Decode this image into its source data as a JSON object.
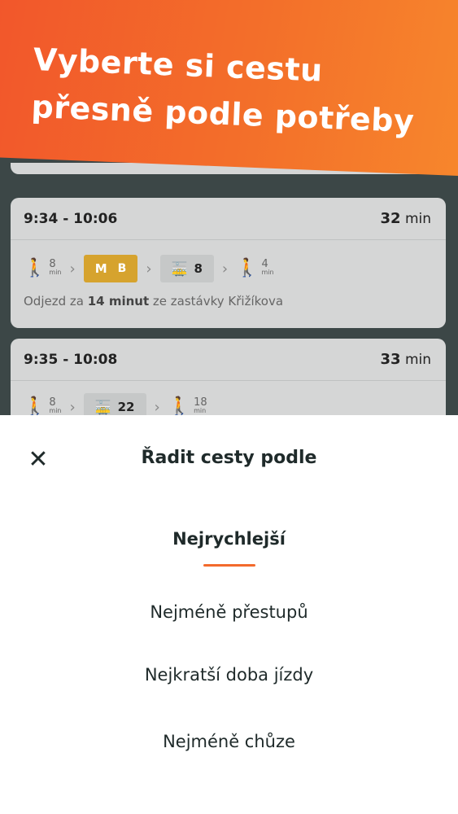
{
  "banner": {
    "line1": "Vyberte si cestu",
    "line2": "přesně podle potřeby"
  },
  "trips": [
    {
      "times": "9:34 - 10:06",
      "duration_value": "32",
      "duration_unit": "min",
      "legs": [
        {
          "type": "walk",
          "icon": "walk-icon",
          "minutes": "8",
          "unit": "min"
        },
        {
          "type": "metro",
          "icon": "metro-icon",
          "logo": "M",
          "line": "B"
        },
        {
          "type": "tram",
          "icon": "tram-icon",
          "line": "8"
        },
        {
          "type": "walk",
          "icon": "walk-icon",
          "minutes": "4",
          "unit": "min"
        }
      ],
      "depart_prefix": "Odjezd za",
      "depart_time": "14 minut",
      "depart_suffix": "ze zastávky Křižíkova"
    },
    {
      "times": "9:35 - 10:08",
      "duration_value": "33",
      "duration_unit": "min",
      "legs": [
        {
          "type": "walk",
          "icon": "walk-icon",
          "minutes": "8",
          "unit": "min"
        },
        {
          "type": "tram",
          "icon": "tram-icon",
          "line": "22"
        },
        {
          "type": "walk",
          "icon": "walk-icon",
          "minutes": "18",
          "unit": "min"
        }
      ]
    }
  ],
  "sheet": {
    "close_icon": "close-icon",
    "title": "Řadit cesty podle",
    "options": [
      {
        "label": "Nejrychlejší",
        "selected": true
      },
      {
        "label": "Nejméně přestupů",
        "selected": false
      },
      {
        "label": "Nejkratší doba jízdy",
        "selected": false
      },
      {
        "label": "Nejméně chůze",
        "selected": false
      }
    ]
  },
  "colors": {
    "accent": "#f36a2c",
    "metro": "#d6a32e",
    "overlay_bg": "#3c4747"
  }
}
